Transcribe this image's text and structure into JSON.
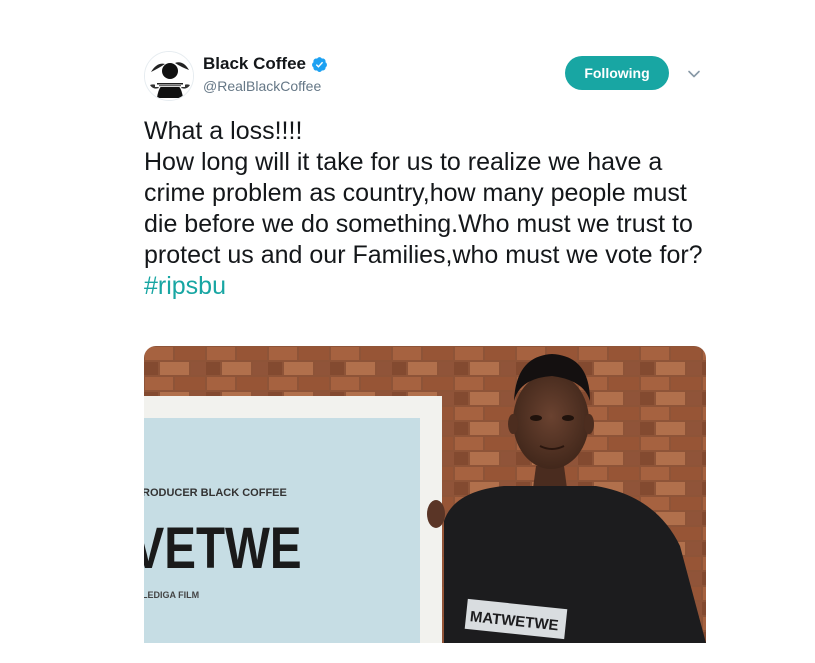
{
  "author": {
    "display_name": "Black Coffee",
    "handle": "@RealBlackCoffee",
    "verified": true,
    "verified_icon": "verified-badge-icon",
    "avatar_icon": "avatar-logo-icon"
  },
  "actions": {
    "follow_label": "Following",
    "more_icon": "chevron-down-icon"
  },
  "tweet": {
    "text": "What a loss!!!!\nHow long will it take for us to realize we have a crime problem as country,how many people must die before we do something.Who must we trust to protect us and our Families,who must we vote for?",
    "hashtag": "#ripsbu"
  },
  "media": {
    "poster_top": "RODUCER BLACK COFFEE",
    "poster_title": "VETWE",
    "poster_bottom": "LEDIGA FILM",
    "shirt_text": "MATWETWE"
  },
  "colors": {
    "accent": "#18a6a3",
    "verified": "#1da1f2",
    "text": "#14171a",
    "muted": "#657786"
  }
}
